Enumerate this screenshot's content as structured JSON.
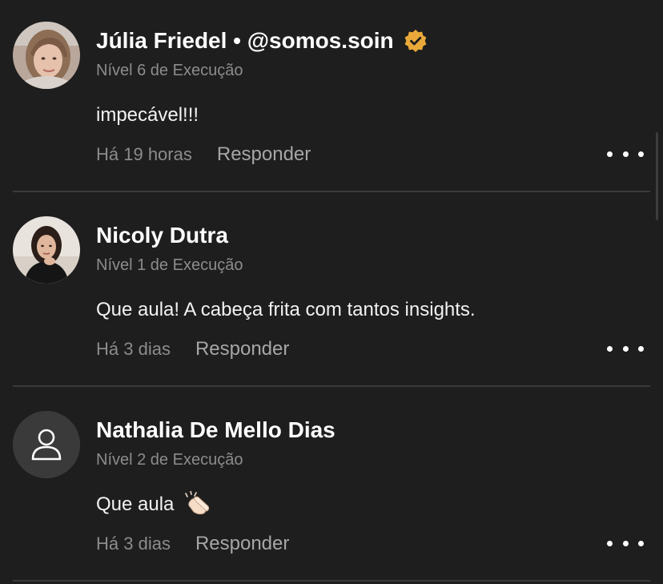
{
  "accent": "#e9a93a",
  "comments": [
    {
      "author": "Júlia Friedel • @somos.soin",
      "verified": true,
      "level": "Nível 6 de Execução",
      "text": "impecável!!!",
      "time": "Há 19 horas",
      "reply_label": "Responder",
      "avatar": "photo-woman-light-hair"
    },
    {
      "author": "Nicoly Dutra",
      "verified": false,
      "level": "Nível 1 de Execução",
      "text": "Que aula! A cabeça frita com tantos insights.",
      "time": "Há 3 dias",
      "reply_label": "Responder",
      "avatar": "photo-woman-dark-hair"
    },
    {
      "author": "Nathalia De Mello Dias",
      "verified": false,
      "level": "Nível 2 de Execução",
      "text": "Que aula",
      "emoji": "clapping-hands-emoji",
      "time": "Há 3 dias",
      "reply_label": "Responder",
      "avatar": "default-user-icon"
    }
  ]
}
